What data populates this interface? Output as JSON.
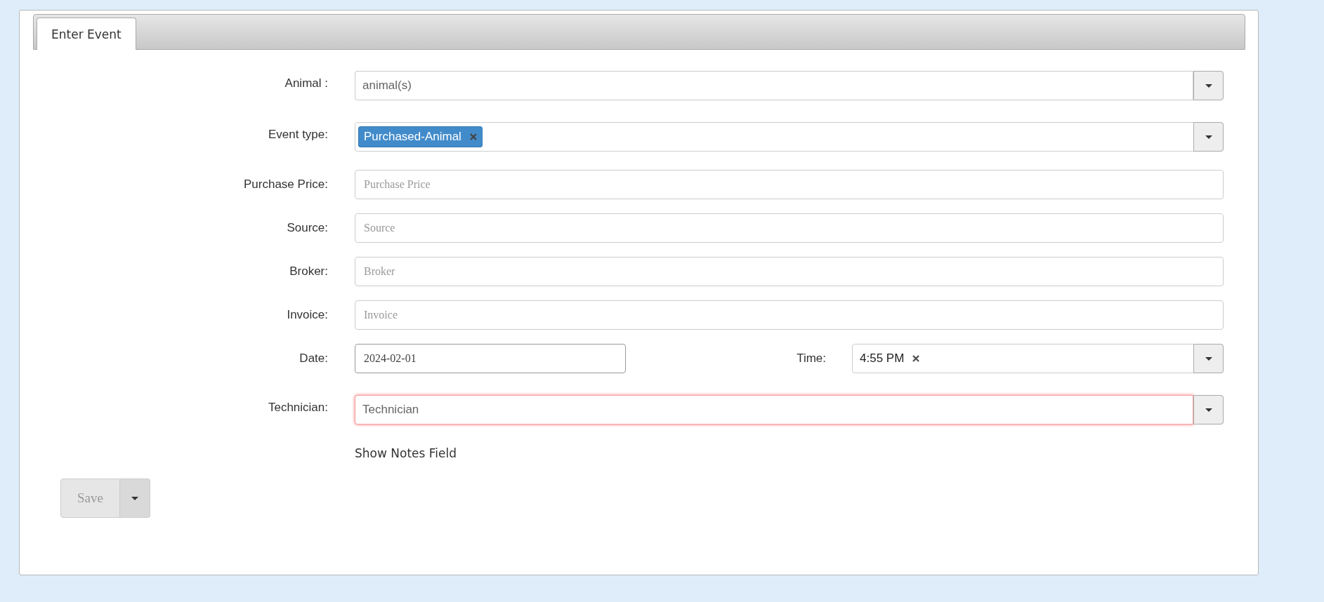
{
  "tabs": [
    {
      "label": "Enter Event",
      "selected": true
    }
  ],
  "fields": [
    {
      "kind": "select",
      "label": "Animal :",
      "placeholder": "animal(s)",
      "invalid": false
    },
    {
      "kind": "tags",
      "label": "Event type:",
      "tags": [
        "Purchased-Animal"
      ]
    },
    {
      "kind": "text",
      "label": "Purchase Price:",
      "placeholder": "Purchase Price"
    },
    {
      "kind": "text",
      "label": "Source:",
      "placeholder": "Source"
    },
    {
      "kind": "text",
      "label": "Broker:",
      "placeholder": "Broker"
    },
    {
      "kind": "text",
      "label": "Invoice:",
      "placeholder": "Invoice"
    },
    {
      "kind": "datetime",
      "label": "Date:",
      "value": "2024-02-01",
      "time_label": "Time:",
      "time_value": "4:55 PM"
    },
    {
      "kind": "select",
      "label": "Technician:",
      "placeholder": "Technician",
      "invalid": true
    }
  ],
  "notes_link": "Show Notes Field",
  "save_button": {
    "label": "Save",
    "disabled": true
  }
}
